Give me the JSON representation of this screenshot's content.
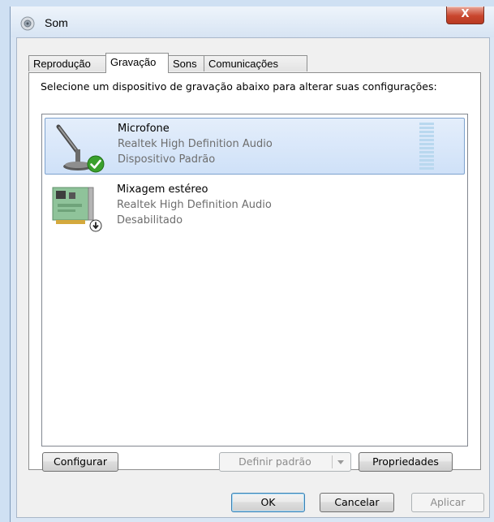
{
  "window": {
    "title": "Som",
    "close_glyph": "X"
  },
  "tabs": [
    {
      "label": "Reprodução",
      "active": false
    },
    {
      "label": "Gravação",
      "active": true
    },
    {
      "label": "Sons",
      "active": false
    },
    {
      "label": "Comunicações",
      "active": false
    }
  ],
  "instruction": "Selecione um dispositivo de gravação abaixo para alterar suas configurações:",
  "devices": [
    {
      "name": "Microfone",
      "driver": "Realtek High Definition Audio",
      "status": "Dispositivo Padrão",
      "selected": true,
      "icon": "microphone-icon",
      "badge": "default-check-badge-icon",
      "level_bars": 10
    },
    {
      "name": "Mixagem estéreo",
      "driver": "Realtek High Definition Audio",
      "status": "Desabilitado",
      "selected": false,
      "icon": "sound-card-icon",
      "badge": "disabled-arrow-badge-icon"
    }
  ],
  "buttons": {
    "configure": "Configurar",
    "set_default": "Definir padrão",
    "properties": "Propriedades",
    "ok": "OK",
    "cancel": "Cancelar",
    "apply": "Aplicar"
  },
  "colors": {
    "selection_border": "#7da2ce",
    "check_green": "#3aa02c",
    "close_red": "#c9462e"
  }
}
